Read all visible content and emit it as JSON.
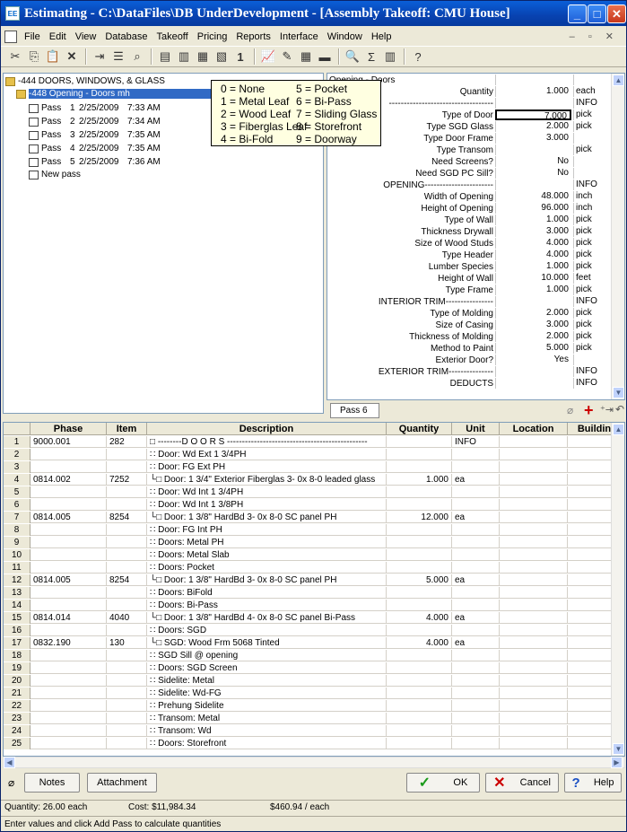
{
  "title": "Estimating - C:\\DataFiles\\DB UnderDevelopment - [Assembly Takeoff:  CMU House]",
  "menu": [
    "File",
    "Edit",
    "View",
    "Database",
    "Takeoff",
    "Pricing",
    "Reports",
    "Interface",
    "Window",
    "Help"
  ],
  "tree": {
    "root": "-444 DOORS, WINDOWS, & GLASS",
    "child": "-448  Opening - Doors mh",
    "passes": [
      {
        "label": "Pass",
        "num": "1",
        "date": "2/25/2009",
        "time": "7:33 AM"
      },
      {
        "label": "Pass",
        "num": "2",
        "date": "2/25/2009",
        "time": "7:34 AM"
      },
      {
        "label": "Pass",
        "num": "3",
        "date": "2/25/2009",
        "time": "7:35 AM"
      },
      {
        "label": "Pass",
        "num": "4",
        "date": "2/25/2009",
        "time": "7:35 AM"
      },
      {
        "label": "Pass",
        "num": "5",
        "date": "2/25/2009",
        "time": "7:36 AM"
      }
    ],
    "new_pass": "New pass"
  },
  "popup": [
    "0 = None",
    "1 = Metal Leaf",
    "2 = Wood Leaf",
    "3 = Fiberglas Leaf",
    "4 = Bi-Fold",
    "5 = Pocket",
    "6 = Bi-Pass",
    "7 = Sliding Glass",
    "8 = Storefront",
    "9 = Doorway"
  ],
  "props": [
    {
      "label": "Opening - Doors",
      "value": "",
      "unit": "",
      "left": true
    },
    {
      "label": "Quantity",
      "value": "1.000",
      "unit": "each"
    },
    {
      "label": "-----------------------------------",
      "value": "",
      "unit": "INFO"
    },
    {
      "label": "Type of Door",
      "value": "7.000",
      "unit": "pick"
    },
    {
      "label": "Type SGD Glass",
      "value": "2.000",
      "unit": "pick"
    },
    {
      "label": "Type Door Frame",
      "value": "3.000",
      "unit": ""
    },
    {
      "label": "Type Transom",
      "value": "",
      "unit": "pick"
    },
    {
      "label": "Need Screens?",
      "value": "No",
      "unit": ""
    },
    {
      "label": "Need SGD PC Sill?",
      "value": "No",
      "unit": ""
    },
    {
      "label": "OPENING-----------------------",
      "value": "",
      "unit": "INFO"
    },
    {
      "label": "Width of Opening",
      "value": "48.000",
      "unit": "inch"
    },
    {
      "label": "Height of Opening",
      "value": "96.000",
      "unit": "inch"
    },
    {
      "label": "Type of Wall",
      "value": "1.000",
      "unit": "pick"
    },
    {
      "label": "Thickness Drywall",
      "value": "3.000",
      "unit": "pick"
    },
    {
      "label": "Size of Wood Studs",
      "value": "4.000",
      "unit": "pick"
    },
    {
      "label": "Type Header",
      "value": "4.000",
      "unit": "pick"
    },
    {
      "label": "Lumber Species",
      "value": "1.000",
      "unit": "pick"
    },
    {
      "label": "Height of Wall",
      "value": "10.000",
      "unit": "feet"
    },
    {
      "label": "Type Frame",
      "value": "1.000",
      "unit": "pick"
    },
    {
      "label": "INTERIOR TRIM----------------",
      "value": "",
      "unit": "INFO"
    },
    {
      "label": "Type of Molding",
      "value": "2.000",
      "unit": "pick"
    },
    {
      "label": "Size of Casing",
      "value": "3.000",
      "unit": "pick"
    },
    {
      "label": "Thickness of Molding",
      "value": "2.000",
      "unit": "pick"
    },
    {
      "label": "Method to Paint",
      "value": "5.000",
      "unit": "pick"
    },
    {
      "label": "Exterior Door?",
      "value": "Yes",
      "unit": ""
    },
    {
      "label": "EXTERIOR TRIM---------------",
      "value": "",
      "unit": "INFO"
    },
    {
      "label": "DEDUCTS",
      "value": "",
      "unit": "INFO"
    }
  ],
  "pass_tab": "Pass 6",
  "grid": {
    "headers": [
      "",
      "Phase",
      "Item",
      "Description",
      "Quantity",
      "Unit",
      "Location",
      "Buildin"
    ],
    "rows": [
      [
        "1",
        "9000.001",
        "282",
        "□ --------D O O R S -----------------------------------------------",
        "",
        "INFO"
      ],
      [
        "2",
        "",
        "",
        "∷ Door: Wd Ext 1 3/4PH",
        "",
        ""
      ],
      [
        "3",
        "",
        "",
        "∷ Door: FG Ext PH",
        "",
        ""
      ],
      [
        "4",
        "0814.002",
        "7252",
        "  └□ Door: 1 3/4\" Exterior Fiberglas 3- 0x 8-0  leaded glass",
        "1.000",
        "ea"
      ],
      [
        "5",
        "",
        "",
        "∷ Door: Wd Int 1 3/4PH",
        "",
        ""
      ],
      [
        "6",
        "",
        "",
        "∷ Door: Wd Int 1 3/8PH",
        "",
        ""
      ],
      [
        "7",
        "0814.005",
        "8254",
        "  └□ Door: 1 3/8\" HardBd 3- 0x 8-0  SC panel PH",
        "12.000",
        "ea"
      ],
      [
        "8",
        "",
        "",
        "∷ Door: FG Int PH",
        "",
        ""
      ],
      [
        "9",
        "",
        "",
        "∷ Doors: Metal PH",
        "",
        ""
      ],
      [
        "10",
        "",
        "",
        "∷ Doors: Metal Slab",
        "",
        ""
      ],
      [
        "11",
        "",
        "",
        "∷ Doors: Pocket",
        "",
        ""
      ],
      [
        "12",
        "0814.005",
        "8254",
        "  └□ Door: 1 3/8\" HardBd 3- 0x 8-0  SC panel PH",
        "5.000",
        "ea"
      ],
      [
        "13",
        "",
        "",
        "∷ Doors: BiFold",
        "",
        ""
      ],
      [
        "14",
        "",
        "",
        "∷ Doors: Bi-Pass",
        "",
        ""
      ],
      [
        "15",
        "0814.014",
        "4040",
        "  └□ Door: 1 3/8\" HardBd 4- 0x 8-0  SC panel Bi-Pass",
        "4.000",
        "ea"
      ],
      [
        "16",
        "",
        "",
        "∷ Doors: SGD",
        "",
        ""
      ],
      [
        "17",
        "0832.190",
        "130",
        "  └□ SGD: Wood Frm 5068 Tinted",
        "4.000",
        "ea"
      ],
      [
        "18",
        "",
        "",
        "∷ SGD Sill @ opening",
        "",
        ""
      ],
      [
        "19",
        "",
        "",
        "∷ Doors: SGD Screen",
        "",
        ""
      ],
      [
        "20",
        "",
        "",
        "∷ Sidelite: Metal",
        "",
        ""
      ],
      [
        "21",
        "",
        "",
        "∷ Sidelite: Wd-FG",
        "",
        ""
      ],
      [
        "22",
        "",
        "",
        "∷ Prehung Sidelite",
        "",
        ""
      ],
      [
        "23",
        "",
        "",
        "∷ Transom: Metal",
        "",
        ""
      ],
      [
        "24",
        "",
        "",
        "∷ Transom: Wd",
        "",
        ""
      ],
      [
        "25",
        "",
        "",
        "∷ Doors: Storefront",
        "",
        ""
      ]
    ]
  },
  "buttons": {
    "notes": "Notes",
    "attachment": "Attachment",
    "ok": "OK",
    "cancel": "Cancel",
    "help": "Help"
  },
  "status": {
    "quantity": "Quantity: 26.00 each",
    "cost": "Cost: $11,984.34",
    "per_each": "$460.94 / each",
    "hint": "Enter values and click Add Pass to calculate quantities"
  }
}
